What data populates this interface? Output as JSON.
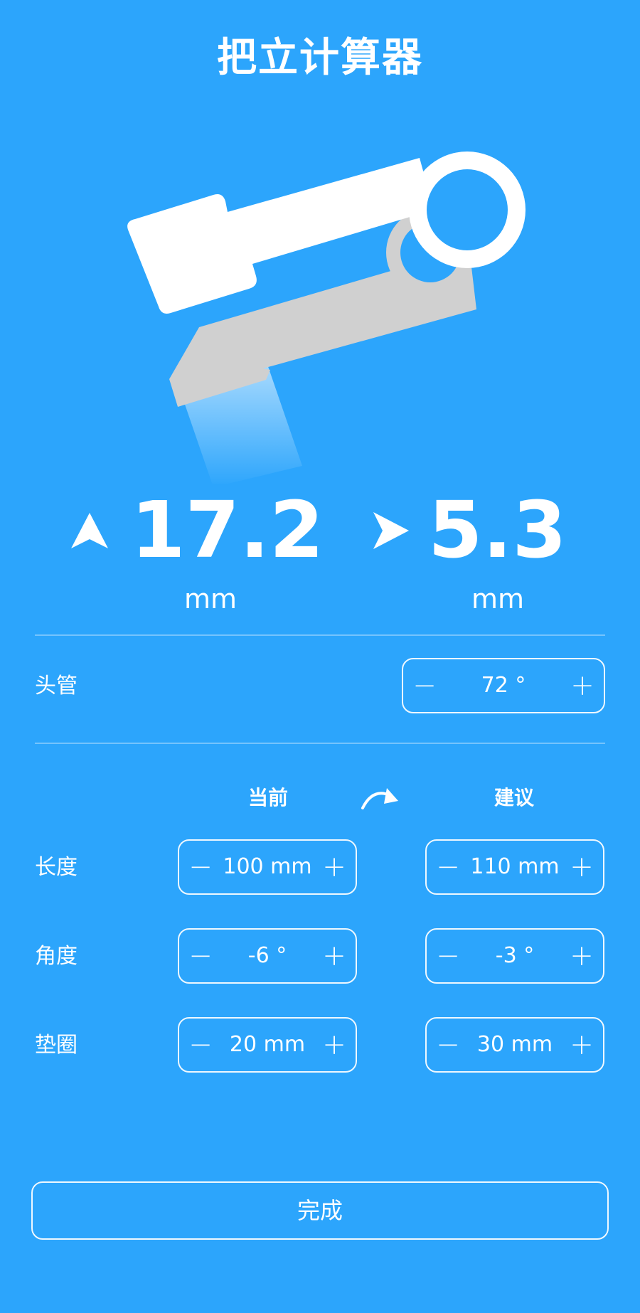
{
  "app": {
    "title": "把立计算器"
  },
  "readouts": {
    "rise": {
      "value": "17.2",
      "unit": "mm",
      "icon": "up-arrow-icon"
    },
    "reach": {
      "value": "5.3",
      "unit": "mm",
      "icon": "right-arrow-icon"
    }
  },
  "head_tube": {
    "label": "头管",
    "value": "72 °",
    "minus": "−",
    "plus": "+"
  },
  "columns": {
    "current": "当前",
    "suggested": "建议",
    "swap_icon": "curved-arrow-icon"
  },
  "rows": [
    {
      "label": "长度",
      "current": "100 mm",
      "suggested": "110 mm",
      "minus": "−",
      "plus": "+"
    },
    {
      "label": "角度",
      "current": "-6 °",
      "suggested": "-3 °",
      "minus": "−",
      "plus": "+"
    },
    {
      "label": "垫圈",
      "current": "20 mm",
      "suggested": "30 mm",
      "minus": "−",
      "plus": "+"
    }
  ],
  "done_label": "完成",
  "colors": {
    "background": "#2ca5fc",
    "foreground": "#ffffff",
    "shadow_part": "#d0d0d0"
  }
}
